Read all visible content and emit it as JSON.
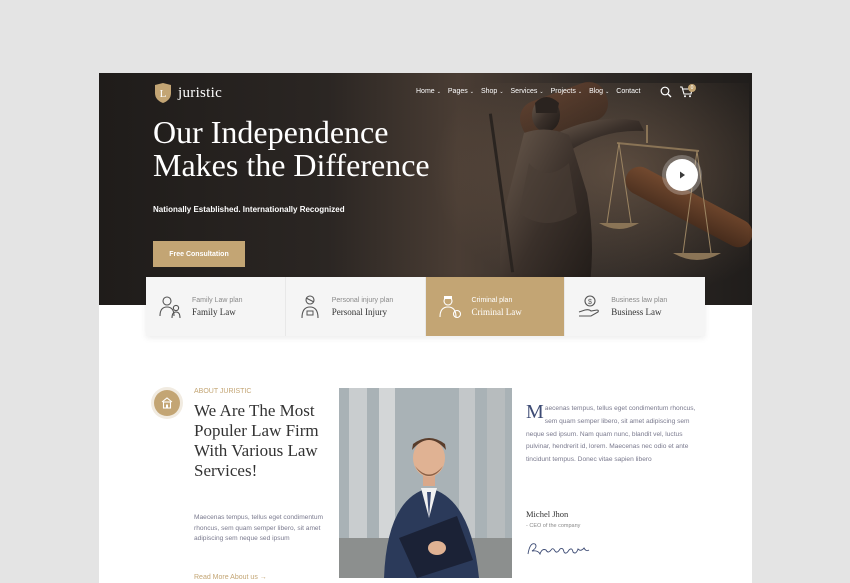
{
  "brand": {
    "name": "juristic",
    "logo_letter": "L",
    "accent": "#c3a574"
  },
  "nav": {
    "items": [
      {
        "label": "Home",
        "has_caret": true
      },
      {
        "label": "Pages",
        "has_caret": true
      },
      {
        "label": "Shop",
        "has_caret": true
      },
      {
        "label": "Services",
        "has_caret": true
      },
      {
        "label": "Projects",
        "has_caret": true
      },
      {
        "label": "Blog",
        "has_caret": true
      },
      {
        "label": "Contact",
        "has_caret": false
      }
    ],
    "caret": "⌄",
    "cart_count": "0"
  },
  "hero": {
    "title_line1": "Our Independence",
    "title_line2": "Makes the Difference",
    "subtitle": "Nationally Established. Internationally Recognized",
    "cta_label": "Free Consultation"
  },
  "services": [
    {
      "small": "Family Law plan",
      "title": "Family Law",
      "icon": "family-icon",
      "active": false
    },
    {
      "small": "Personal injury plan",
      "title": "Personal Injury",
      "icon": "injury-icon",
      "active": false
    },
    {
      "small": "Criminal plan",
      "title": "Criminal Law",
      "icon": "criminal-icon",
      "active": true
    },
    {
      "small": "Business law plan",
      "title": "Business Law",
      "icon": "business-icon",
      "active": false
    }
  ],
  "about": {
    "eyebrow": "ABOUT JURISTIC",
    "heading": "We Are The Most Populer Law Firm With Various Law Services!",
    "text": "Maecenas tempus, tellus eget condimentum rhoncus, sem quam semper libero, sit amet adipiscing sem neque sed ipsum",
    "read_more": "Read More About us →"
  },
  "quote": {
    "dropcap": "M",
    "text": "aecenas tempus, tellus eget condimentum rhoncus, sem quam semper libero, sit amet adipiscing sem neque sed ipsum. Nam quam nunc, blandit vel, luctus pulvinar, hendrerit id, lorem. Maecenas nec odio et ante tincidunt tempus. Donec vitae sapien libero",
    "name": "Michel Jhon",
    "role": "- CEO of the company"
  }
}
